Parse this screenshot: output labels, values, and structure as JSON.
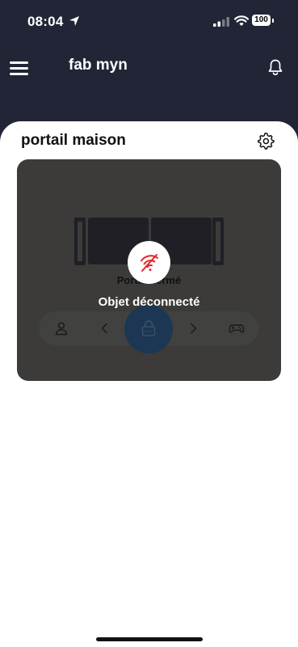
{
  "status_bar": {
    "time": "08:04",
    "battery": "100"
  },
  "header": {
    "title": "fab myn"
  },
  "device": {
    "name": "portail maison",
    "state_label": "Portail fermé",
    "offline_message": "Objet déconnecté"
  },
  "icons": {
    "menu": "hamburger-menu-icon",
    "notifications": "bell-icon",
    "settings": "gear-icon",
    "offline": "wifi-off-icon",
    "user": "person-icon",
    "previous": "chevron-left-icon",
    "lock": "lock-icon",
    "next": "chevron-right-icon",
    "remote": "gamepad-icon"
  },
  "colors": {
    "header_bg": "#222536",
    "card_overlay": "#3c3b39",
    "offline_red": "#e0262b",
    "lock_button": "#1b3754"
  }
}
